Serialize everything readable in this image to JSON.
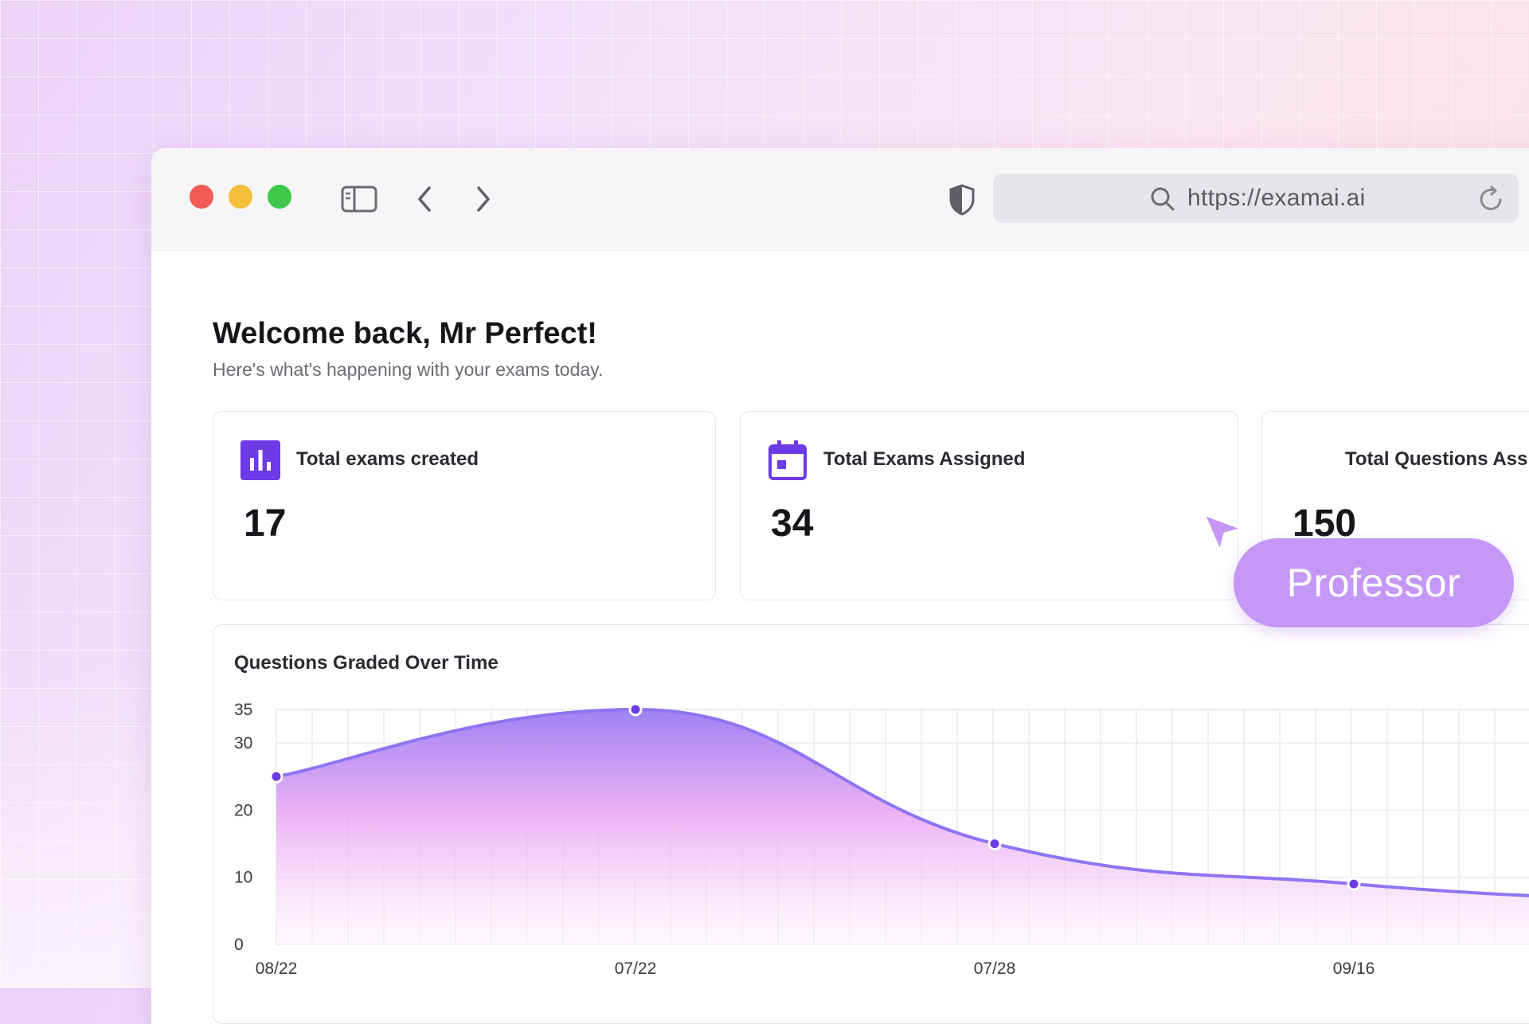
{
  "browser": {
    "url": "https://examai.ai"
  },
  "dashboard": {
    "welcome_title": "Welcome back, Mr Perfect!",
    "welcome_subtitle": "Here's what's happening with your exams today.",
    "stats": [
      {
        "label": "Total exams created",
        "value": "17",
        "icon": "bar-chart-icon"
      },
      {
        "label": "Total Exams Assigned",
        "value": "34",
        "icon": "calendar-icon"
      },
      {
        "label": "Total Questions Ass",
        "value": "150",
        "icon": "questions-icon"
      }
    ],
    "chart_title": "Questions Graded Over Time"
  },
  "overlay": {
    "role_label": "Professor"
  },
  "colors": {
    "accent": "#6d3be6",
    "line": "#8f74f2",
    "pill": "#c597f6"
  },
  "chart_data": {
    "type": "area",
    "title": "Questions Graded Over Time",
    "xlabel": "",
    "ylabel": "",
    "x": [
      "08/22",
      "07/22",
      "07/28",
      "09/16"
    ],
    "series": [
      {
        "values": [
          25,
          35,
          15,
          9
        ]
      }
    ],
    "y_ticks": [
      0,
      10,
      20,
      30,
      35
    ],
    "ylim": [
      0,
      35
    ],
    "grid": true,
    "legend": "none"
  }
}
